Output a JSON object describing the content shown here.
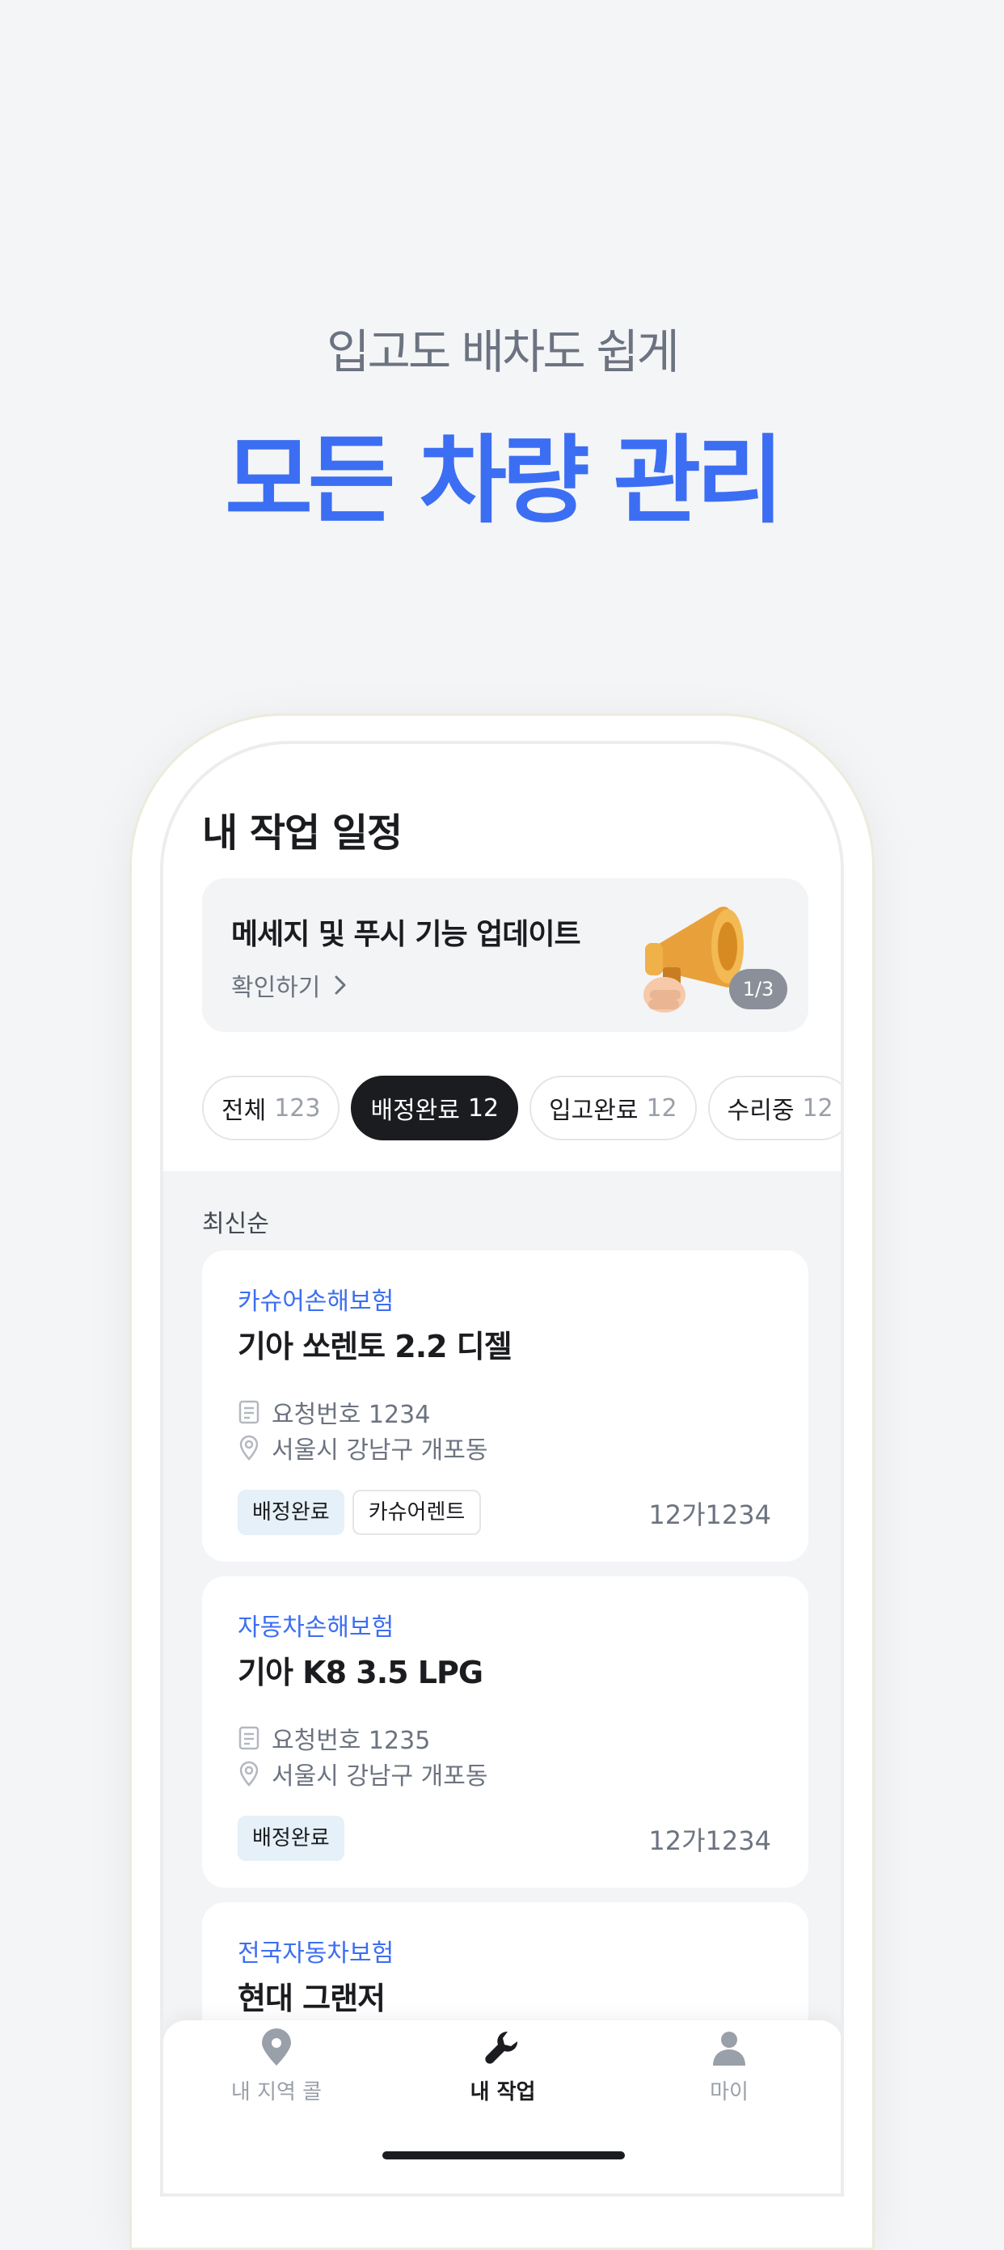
{
  "hero": {
    "subtitle": "입고도 배차도 쉽게",
    "title": "모든 차량 관리"
  },
  "screen": {
    "title": "내 작업 일정",
    "banner": {
      "title": "메세지 및 푸시 기능 업데이트",
      "link_label": "확인하기",
      "link_icon": "chevron-right-icon",
      "image_icon": "megaphone-icon",
      "pager": "1/3"
    },
    "filters": [
      {
        "label": "전체",
        "count": "123",
        "active": false
      },
      {
        "label": "배정완료",
        "count": "12",
        "active": true
      },
      {
        "label": "입고완료",
        "count": "12",
        "active": false
      },
      {
        "label": "수리중",
        "count": "12",
        "active": false
      }
    ],
    "sort_label": "최신순",
    "cards": [
      {
        "company": "카슈어손해보험",
        "vehicle": "기아 쏘렌토 2.2 디젤",
        "request_no": "요청번호 1234",
        "address": "서울시 강남구 개포동",
        "tags": [
          "배정완료",
          "카슈어렌트"
        ],
        "plate": "12가1234"
      },
      {
        "company": "자동차손해보험",
        "vehicle": "기아 K8 3.5 LPG",
        "request_no": "요청번호 1235",
        "address": "서울시 강남구 개포동",
        "tags": [
          "배정완료"
        ],
        "plate": "12가1234"
      },
      {
        "company": "전국자동차보험",
        "vehicle": "현대 그랜저"
      }
    ],
    "nav": [
      {
        "label": "내 지역 콜",
        "icon": "location-pin-icon",
        "active": false
      },
      {
        "label": "내 작업",
        "icon": "wrench-icon",
        "active": true
      },
      {
        "label": "마이",
        "icon": "person-icon",
        "active": false
      }
    ]
  },
  "colors": {
    "accent": "#3c6ef3",
    "dark": "#1b1c1f",
    "muted": "#6c7380",
    "tag_blue": "#e5f0f8",
    "background": "#f4f5f7"
  }
}
